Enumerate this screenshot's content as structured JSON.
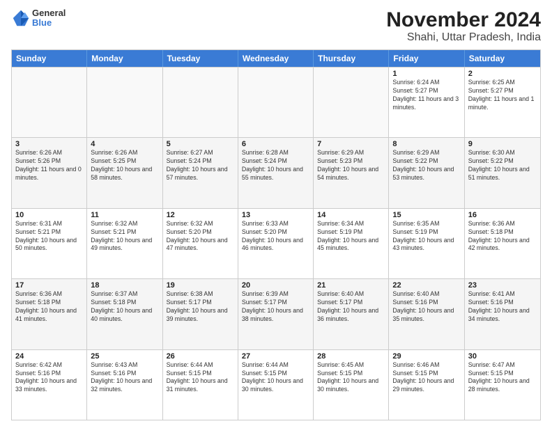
{
  "logo": {
    "general": "General",
    "blue": "Blue"
  },
  "title": "November 2024",
  "location": "Shahi, Uttar Pradesh, India",
  "weekdays": [
    "Sunday",
    "Monday",
    "Tuesday",
    "Wednesday",
    "Thursday",
    "Friday",
    "Saturday"
  ],
  "rows": [
    [
      {
        "day": "",
        "info": ""
      },
      {
        "day": "",
        "info": ""
      },
      {
        "day": "",
        "info": ""
      },
      {
        "day": "",
        "info": ""
      },
      {
        "day": "",
        "info": ""
      },
      {
        "day": "1",
        "info": "Sunrise: 6:24 AM\nSunset: 5:27 PM\nDaylight: 11 hours and 3 minutes."
      },
      {
        "day": "2",
        "info": "Sunrise: 6:25 AM\nSunset: 5:27 PM\nDaylight: 11 hours and 1 minute."
      }
    ],
    [
      {
        "day": "3",
        "info": "Sunrise: 6:26 AM\nSunset: 5:26 PM\nDaylight: 11 hours and 0 minutes."
      },
      {
        "day": "4",
        "info": "Sunrise: 6:26 AM\nSunset: 5:25 PM\nDaylight: 10 hours and 58 minutes."
      },
      {
        "day": "5",
        "info": "Sunrise: 6:27 AM\nSunset: 5:24 PM\nDaylight: 10 hours and 57 minutes."
      },
      {
        "day": "6",
        "info": "Sunrise: 6:28 AM\nSunset: 5:24 PM\nDaylight: 10 hours and 55 minutes."
      },
      {
        "day": "7",
        "info": "Sunrise: 6:29 AM\nSunset: 5:23 PM\nDaylight: 10 hours and 54 minutes."
      },
      {
        "day": "8",
        "info": "Sunrise: 6:29 AM\nSunset: 5:22 PM\nDaylight: 10 hours and 53 minutes."
      },
      {
        "day": "9",
        "info": "Sunrise: 6:30 AM\nSunset: 5:22 PM\nDaylight: 10 hours and 51 minutes."
      }
    ],
    [
      {
        "day": "10",
        "info": "Sunrise: 6:31 AM\nSunset: 5:21 PM\nDaylight: 10 hours and 50 minutes."
      },
      {
        "day": "11",
        "info": "Sunrise: 6:32 AM\nSunset: 5:21 PM\nDaylight: 10 hours and 49 minutes."
      },
      {
        "day": "12",
        "info": "Sunrise: 6:32 AM\nSunset: 5:20 PM\nDaylight: 10 hours and 47 minutes."
      },
      {
        "day": "13",
        "info": "Sunrise: 6:33 AM\nSunset: 5:20 PM\nDaylight: 10 hours and 46 minutes."
      },
      {
        "day": "14",
        "info": "Sunrise: 6:34 AM\nSunset: 5:19 PM\nDaylight: 10 hours and 45 minutes."
      },
      {
        "day": "15",
        "info": "Sunrise: 6:35 AM\nSunset: 5:19 PM\nDaylight: 10 hours and 43 minutes."
      },
      {
        "day": "16",
        "info": "Sunrise: 6:36 AM\nSunset: 5:18 PM\nDaylight: 10 hours and 42 minutes."
      }
    ],
    [
      {
        "day": "17",
        "info": "Sunrise: 6:36 AM\nSunset: 5:18 PM\nDaylight: 10 hours and 41 minutes."
      },
      {
        "day": "18",
        "info": "Sunrise: 6:37 AM\nSunset: 5:18 PM\nDaylight: 10 hours and 40 minutes."
      },
      {
        "day": "19",
        "info": "Sunrise: 6:38 AM\nSunset: 5:17 PM\nDaylight: 10 hours and 39 minutes."
      },
      {
        "day": "20",
        "info": "Sunrise: 6:39 AM\nSunset: 5:17 PM\nDaylight: 10 hours and 38 minutes."
      },
      {
        "day": "21",
        "info": "Sunrise: 6:40 AM\nSunset: 5:17 PM\nDaylight: 10 hours and 36 minutes."
      },
      {
        "day": "22",
        "info": "Sunrise: 6:40 AM\nSunset: 5:16 PM\nDaylight: 10 hours and 35 minutes."
      },
      {
        "day": "23",
        "info": "Sunrise: 6:41 AM\nSunset: 5:16 PM\nDaylight: 10 hours and 34 minutes."
      }
    ],
    [
      {
        "day": "24",
        "info": "Sunrise: 6:42 AM\nSunset: 5:16 PM\nDaylight: 10 hours and 33 minutes."
      },
      {
        "day": "25",
        "info": "Sunrise: 6:43 AM\nSunset: 5:16 PM\nDaylight: 10 hours and 32 minutes."
      },
      {
        "day": "26",
        "info": "Sunrise: 6:44 AM\nSunset: 5:15 PM\nDaylight: 10 hours and 31 minutes."
      },
      {
        "day": "27",
        "info": "Sunrise: 6:44 AM\nSunset: 5:15 PM\nDaylight: 10 hours and 30 minutes."
      },
      {
        "day": "28",
        "info": "Sunrise: 6:45 AM\nSunset: 5:15 PM\nDaylight: 10 hours and 30 minutes."
      },
      {
        "day": "29",
        "info": "Sunrise: 6:46 AM\nSunset: 5:15 PM\nDaylight: 10 hours and 29 minutes."
      },
      {
        "day": "30",
        "info": "Sunrise: 6:47 AM\nSunset: 5:15 PM\nDaylight: 10 hours and 28 minutes."
      }
    ]
  ]
}
